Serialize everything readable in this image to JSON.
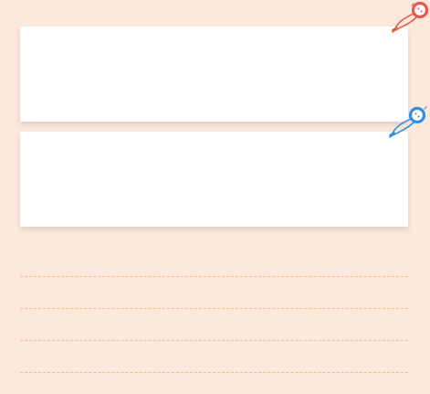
{
  "background_color": "#FDE9DC",
  "cards": [
    {
      "pin_icon": "pushpin-red-icon",
      "pin_color": "#E8594A"
    },
    {
      "pin_icon": "pushpin-blue-icon",
      "pin_color": "#2F8FE0"
    }
  ],
  "ruled_lines": {
    "count": 4,
    "color": "#F2B896",
    "style": "dashed"
  }
}
